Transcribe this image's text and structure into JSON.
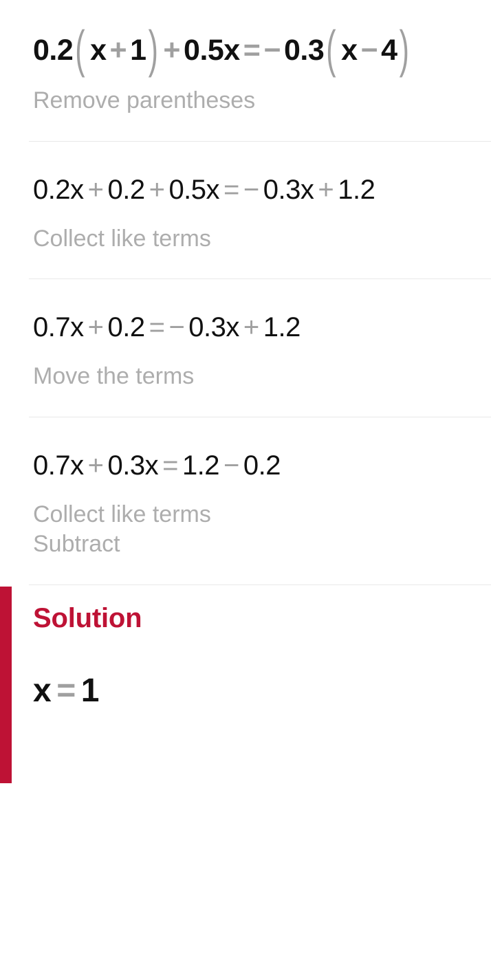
{
  "document": {
    "type": "math-step-by-step-solution",
    "accent_color": "#be1235",
    "operator_color": "#a0a0a0",
    "hint_color": "#adadad",
    "text_color": "#111111",
    "divider_color": "#e8e8e8"
  },
  "problem": {
    "full_text": "0.2(x + 1) + 0.5x = − 0.3(x − 4)",
    "tokens": {
      "t1": "0.2",
      "paren_open_1": "(",
      "t2": "x",
      "op1": "+",
      "t3": "1",
      "paren_close_1": ")",
      "op2": "+",
      "t4": "0.5x",
      "equals": "=",
      "minus": "−",
      "t5": "0.3",
      "paren_open_2": "(",
      "t6": "x",
      "op3": "−",
      "t7": "4",
      "paren_close_2": ")"
    }
  },
  "steps": [
    {
      "hints": [
        "Remove parentheses"
      ],
      "equation_full": "0.2x + 0.2 + 0.5x = − 0.3x + 1.2",
      "tokens": {
        "a": "0.2x",
        "op1": "+",
        "b": "0.2",
        "op2": "+",
        "c": "0.5x",
        "equals": "=",
        "minus": "−",
        "d": "0.3x",
        "op3": "+",
        "e": "1.2"
      }
    },
    {
      "hints": [
        "Collect like terms"
      ],
      "equation_full": "0.7x + 0.2 = − 0.3x + 1.2",
      "tokens": {
        "a": "0.7x",
        "op1": "+",
        "b": "0.2",
        "equals": "=",
        "minus": "−",
        "c": "0.3x",
        "op2": "+",
        "d": "1.2"
      }
    },
    {
      "hints": [
        "Move the terms"
      ],
      "equation_full": "0.7x + 0.3x = 1.2 − 0.2",
      "tokens": {
        "a": "0.7x",
        "op1": "+",
        "b": "0.3x",
        "equals": "=",
        "c": "1.2",
        "op2": "−",
        "d": "0.2"
      }
    },
    {
      "hints": [
        "Collect like terms",
        "Subtract"
      ]
    }
  ],
  "solution": {
    "title": "Solution",
    "answer_full": "x = 1",
    "variable": "x",
    "equals": "=",
    "value": "1"
  }
}
